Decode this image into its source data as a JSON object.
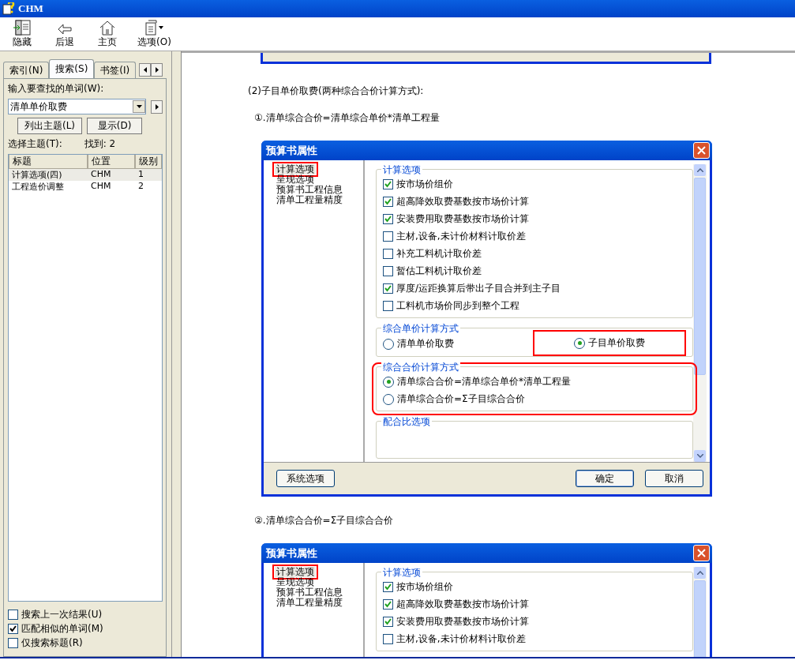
{
  "window": {
    "title": "CHM"
  },
  "toolbar": [
    {
      "label": "隐藏",
      "kind": "hide"
    },
    {
      "label": "后退",
      "kind": "back"
    },
    {
      "label": "主页",
      "kind": "home"
    },
    {
      "label": "选项(O)",
      "kind": "options"
    }
  ],
  "nav_tabs": [
    {
      "label": "索引(N)",
      "selected": false
    },
    {
      "label": "搜索(S)",
      "selected": true
    },
    {
      "label": "书签(I)",
      "selected": false
    }
  ],
  "search": {
    "label": "输入要查找的单词(W):",
    "value": "清单单价取费",
    "buttons": [
      "列出主题(L)",
      "显示(D)"
    ],
    "topics_label": "选择主题(T):",
    "found": "找到: 2",
    "columns": [
      "标题",
      "位置",
      "级别"
    ],
    "rows": [
      {
        "cells": [
          "计算选项(四)",
          "CHM",
          "1"
        ],
        "selected": true
      },
      {
        "cells": [
          "工程造价调整",
          "CHM",
          "2"
        ],
        "selected": false
      }
    ],
    "options": [
      {
        "label": "搜索上一次结果(U)",
        "checked": false
      },
      {
        "label": "匹配相似的单词(M)",
        "checked": true
      },
      {
        "label": "仅搜索标题(R)",
        "checked": false
      }
    ]
  },
  "content": [
    {
      "kind": "dialog-edge"
    },
    {
      "kind": "heading",
      "text": "(2)子目单价取费(两种综合合价计算方式):"
    },
    {
      "kind": "step",
      "text": "①.清单综合合价=清单综合单价*清单工程量"
    },
    {
      "kind": "dialog",
      "title": "预算书属性",
      "tree": [
        {
          "label": "计算选项",
          "selected": true,
          "annotated": true
        },
        {
          "label": "呈现选项",
          "selected": false,
          "annotated": false
        },
        {
          "label": "预算书工程信息",
          "selected": false,
          "annotated": false
        },
        {
          "label": "清单工程量精度",
          "selected": false,
          "annotated": false
        }
      ],
      "groups": [
        {
          "title": "计算选项",
          "kind": "checks",
          "items": [
            {
              "label": "按市场价组价",
              "checked": true
            },
            {
              "label": "超高降效取费基数按市场价计算",
              "checked": true
            },
            {
              "label": "安装费用取费基数按市场价计算",
              "checked": true
            },
            {
              "label": "主材,设备,未计价材料计取价差",
              "checked": false
            },
            {
              "label": "补充工料机计取价差",
              "checked": false
            },
            {
              "label": "暂估工料机计取价差",
              "checked": false
            },
            {
              "label": "厚度/运距换算后带出子目合并到主子目",
              "checked": true
            },
            {
              "label": "工料机市场价同步到整个工程",
              "checked": false
            }
          ]
        },
        {
          "title": "综合单价计算方式",
          "kind": "radios-row",
          "items": [
            {
              "label": "清单单价取费",
              "selected": false,
              "annotated": false
            },
            {
              "label": "子目单价取费",
              "selected": true,
              "annotated": true
            }
          ]
        },
        {
          "title": "综合合价计算方式",
          "kind": "radios",
          "annotated": true,
          "items": [
            {
              "label": "清单综合合价=清单综合单价*清单工程量",
              "selected": true,
              "annotated": false
            },
            {
              "label": "清单综合合价=Σ子目综合合价",
              "selected": false,
              "annotated": false
            }
          ]
        },
        {
          "title": "配合比选项",
          "kind": "checks"
        }
      ],
      "footer": {
        "left": "系统选项",
        "ok": "确定",
        "cancel": "取消"
      }
    },
    {
      "kind": "step",
      "text": "②.清单综合合价=Σ子目综合合价"
    },
    {
      "kind": "dialog",
      "title": "预算书属性",
      "tree": [
        {
          "label": "计算选项",
          "selected": true,
          "annotated": true
        },
        {
          "label": "呈现选项",
          "selected": false,
          "annotated": false
        },
        {
          "label": "预算书工程信息",
          "selected": false,
          "annotated": false
        },
        {
          "label": "清单工程量精度",
          "selected": false,
          "annotated": false
        }
      ],
      "groups": [
        {
          "title": "计算选项",
          "kind": "checks",
          "items": [
            {
              "label": "按市场价组价",
              "checked": true
            },
            {
              "label": "超高降效取费基数按市场价计算",
              "checked": true
            },
            {
              "label": "安装费用取费基数按市场价计算",
              "checked": true
            },
            {
              "label": "主材,设备,未计价材料计取价差",
              "checked": false
            }
          ]
        }
      ]
    }
  ]
}
